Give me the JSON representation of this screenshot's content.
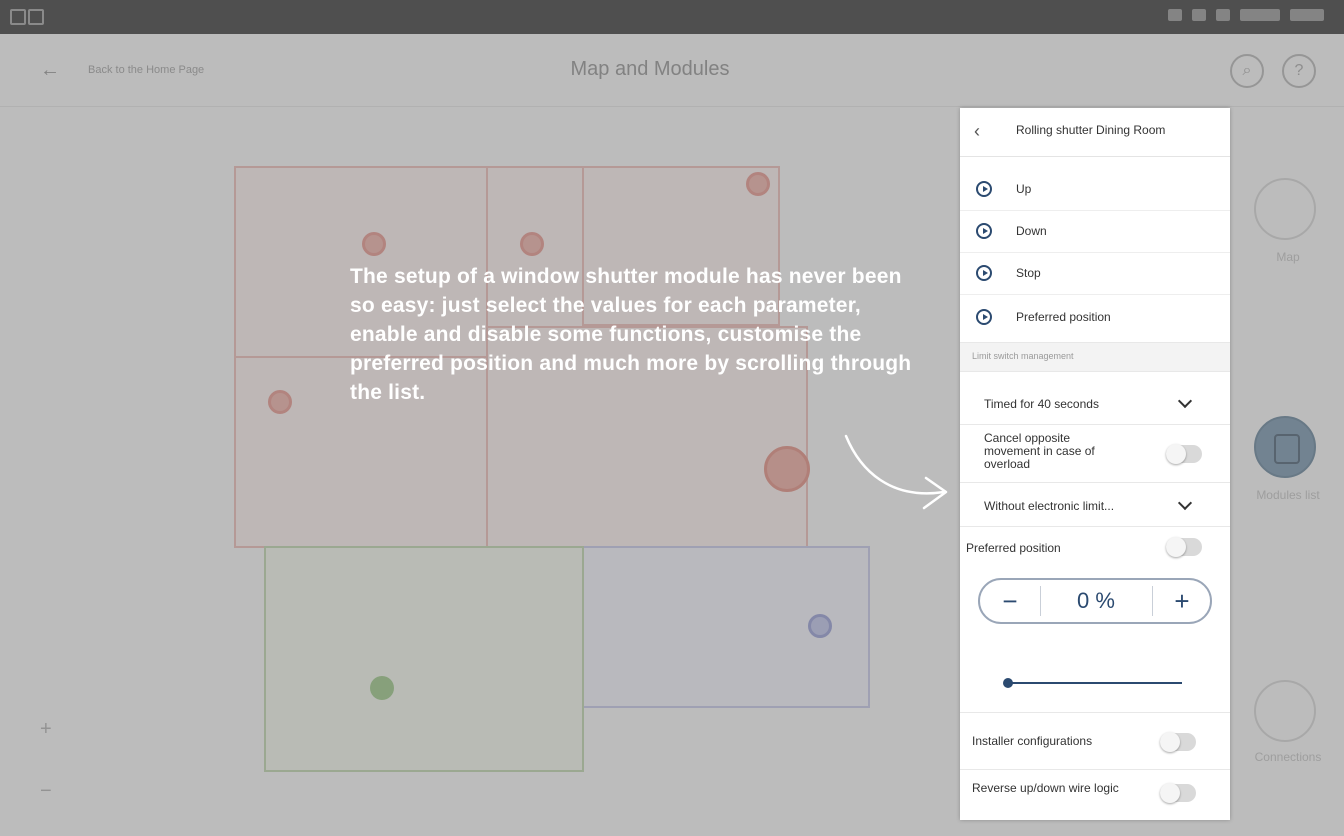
{
  "app": {
    "back_label": "Back to the Home Page",
    "title": "Map and Modules",
    "rail": {
      "map_label": "Map",
      "modules_label": "Modules list",
      "connections_label": "Connections"
    }
  },
  "caption": "The setup of a window shutter module has never been so easy: just select the values for each parameter, enable and disable some functions, customise the preferred position and much more by scrolling through the list.",
  "panel": {
    "title": "Rolling shutter Dining Room",
    "commands": [
      "Up",
      "Down",
      "Stop",
      "Preferred position"
    ],
    "section_label": "Limit switch management",
    "timed_label": "Timed for 40 seconds",
    "cancel_label": "Cancel opposite movement in case of overload",
    "cancel_enabled": false,
    "electronic_label": "Without electronic limit...",
    "preferred_label": "Preferred position",
    "preferred_enabled": false,
    "preferred_value": "0 %",
    "preferred_percent": 0,
    "minus": "−",
    "plus": "+",
    "installer_label": "Installer configurations",
    "installer_enabled": false,
    "reverse_label": "Reverse up/down wire logic",
    "reverse_enabled": false
  },
  "colors": {
    "accent": "#2b4a70"
  }
}
